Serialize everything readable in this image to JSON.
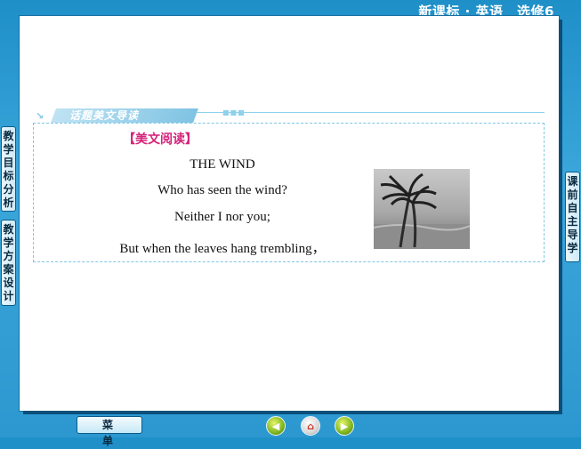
{
  "header": {
    "title": "新课标 · 英语　选修6"
  },
  "slide": {
    "banner_label": "话题美文导读",
    "section_heading": "【美文阅读】",
    "poem": {
      "title": "THE WIND",
      "lines": [
        "Who has seen the wind?",
        "Neither I nor you;",
        "But when the leaves hang trembling，"
      ]
    },
    "photo_icon": "palm-trees-in-wind-photo"
  },
  "side_tabs": {
    "left": [
      "教学目标分析",
      "教学方案设计"
    ],
    "right": [
      "课前自主导学"
    ]
  },
  "footer": {
    "menu_label": "菜单",
    "nav_icons": [
      "previous-icon",
      "home-icon",
      "next-icon"
    ]
  }
}
